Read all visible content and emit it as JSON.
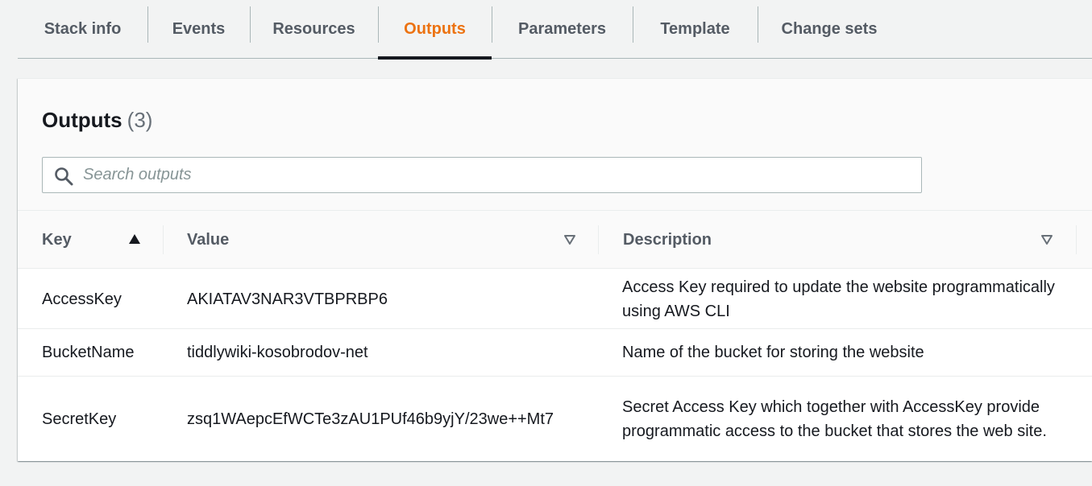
{
  "tabs": [
    {
      "label": "Stack info",
      "active": false
    },
    {
      "label": "Events",
      "active": false
    },
    {
      "label": "Resources",
      "active": false
    },
    {
      "label": "Outputs",
      "active": true
    },
    {
      "label": "Parameters",
      "active": false
    },
    {
      "label": "Template",
      "active": false
    },
    {
      "label": "Change sets",
      "active": false
    }
  ],
  "colors": {
    "accent": "#ec7211",
    "text": "#16191f",
    "muted": "#545b64"
  },
  "outputs": {
    "title": "Outputs",
    "count": "(3)",
    "search": {
      "placeholder": "Search outputs",
      "value": "",
      "icon": "search-icon"
    },
    "columns": {
      "key": {
        "label": "Key",
        "sort_icon": "sort-ascending-icon"
      },
      "value": {
        "label": "Value",
        "sort_icon": "sort-caret-down-icon"
      },
      "description": {
        "label": "Description",
        "sort_icon": "sort-caret-down-icon"
      }
    },
    "rows": [
      {
        "key": "AccessKey",
        "value": "AKIATAV3NAR3VTBPRBP6",
        "description": "Access Key required to update the website programmatically using AWS CLI"
      },
      {
        "key": "BucketName",
        "value": "tiddlywiki-kosobrodov-net",
        "description": "Name of the bucket for storing the website"
      },
      {
        "key": "SecretKey",
        "value": "zsq1WAepcEfWCTe3zAU1PUf46b9yjY/23we++Mt7",
        "description": "Secret Access Key which together with AccessKey provide programmatic access to the bucket that stores the web site."
      }
    ]
  }
}
